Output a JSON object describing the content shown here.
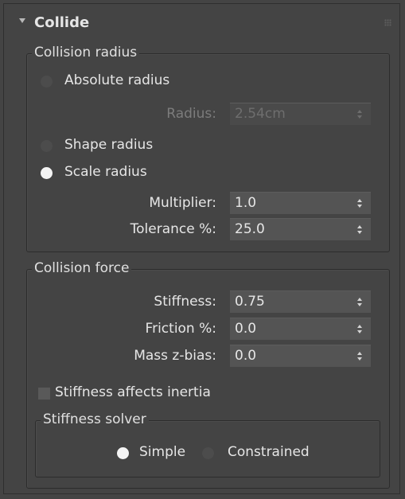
{
  "rollout": {
    "title": "Collide",
    "expanded": true
  },
  "collision_radius": {
    "group_title": "Collision radius",
    "absolute_radius": {
      "label": "Absolute radius",
      "selected": false
    },
    "radius": {
      "label": "Radius:",
      "value": "2.54cm",
      "enabled": false
    },
    "shape_radius": {
      "label": "Shape radius",
      "selected": false
    },
    "scale_radius": {
      "label": "Scale radius",
      "selected": true
    },
    "multiplier": {
      "label": "Multiplier:",
      "value": "1.0"
    },
    "tolerance": {
      "label": "Tolerance %:",
      "value": "25.0"
    }
  },
  "collision_force": {
    "group_title": "Collision force",
    "stiffness": {
      "label": "Stiffness:",
      "value": "0.75"
    },
    "friction": {
      "label": "Friction %:",
      "value": "0.0"
    },
    "mass_z_bias": {
      "label": "Mass z-bias:",
      "value": "0.0"
    },
    "stiffness_affects_inertia": {
      "label": "Stiffness affects inertia",
      "checked": false
    },
    "stiffness_solver": {
      "group_title": "Stiffness solver",
      "simple": {
        "label": "Simple",
        "selected": true
      },
      "constrained": {
        "label": "Constrained",
        "selected": false
      }
    }
  },
  "colors": {
    "panel_bg": "#444444",
    "field_bg": "#545454",
    "text": "#e6e6e6",
    "disabled_text": "#7c7c7c",
    "radio_selected": "#f4f4f4"
  }
}
